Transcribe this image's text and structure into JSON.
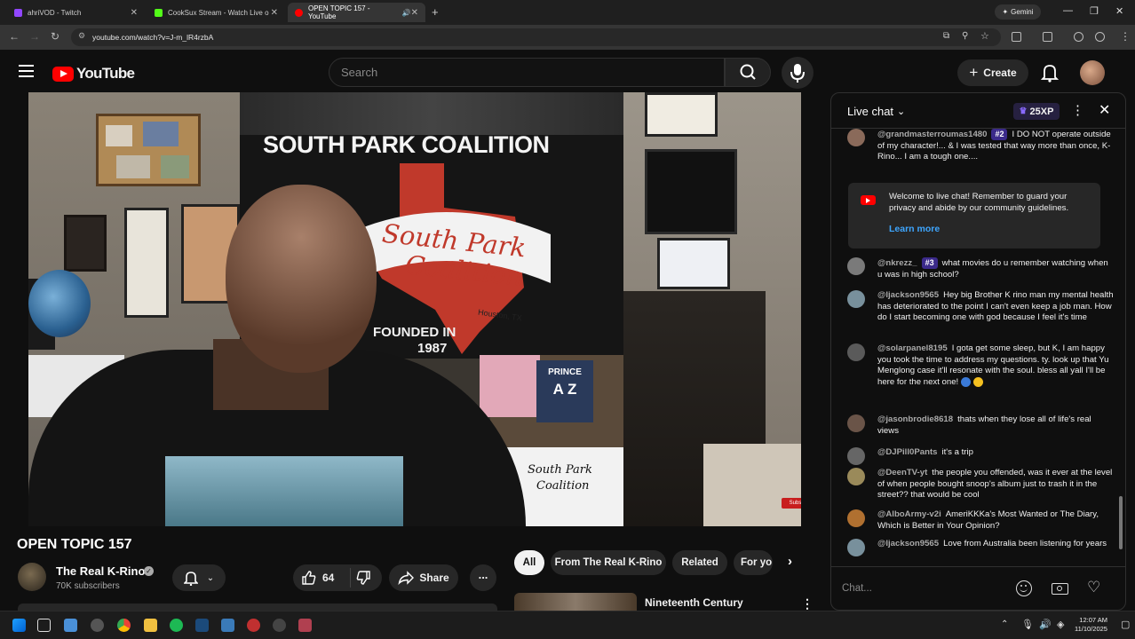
{
  "browser": {
    "tabs": [
      {
        "label": "ahriVOD - Twitch",
        "color": "#9146ff"
      },
      {
        "label": "CookSux Stream - Watch Live o",
        "color": "#53fc18"
      },
      {
        "label": "OPEN TOPIC 157 - YouTube",
        "color": "#ff0000"
      }
    ],
    "new_tab": "+",
    "gemini_label": "Gemini",
    "url": "youtube.com/watch?v=J-m_lR4rzbA"
  },
  "youtube": {
    "logo_text": "YouTube",
    "search_placeholder": "Search",
    "create_label": "Create"
  },
  "video": {
    "banner_title": "SOUTH PARK COALITION",
    "texas_text_1": "South Park",
    "texas_text_2": "Coalition",
    "texas_text_3": "Houston, TX",
    "founded_text": "FOUNDED IN",
    "founded_year": "1987",
    "prince_text": "PRINCE",
    "az_text": "A Z",
    "shirt_text_1": "South Park",
    "shirt_text_2": "Coalition",
    "watermark": "Subscribe"
  },
  "meta": {
    "title": "OPEN TOPIC 157",
    "channel_name": "The Real K-Rino",
    "subscribers": "70K subscribers",
    "likes": "64",
    "share_label": "Share",
    "more_label": "..."
  },
  "chips": {
    "items": [
      "All",
      "From The Real K-Rino",
      "Related",
      "For yo"
    ],
    "rec_title": "Nineteenth Century"
  },
  "chat": {
    "header_title": "Live chat",
    "xp": "25XP",
    "messages": [
      {
        "author": "@grandmasterroumas1480",
        "badge": "#2",
        "text": "I DO NOT operate outside of my character!... & I was tested that way more than once, K-Rino... I am a tough one....",
        "avatar": "#8a6a5a"
      },
      {
        "author": "@nkrezz_",
        "badge": "#3",
        "text": "what movies do u remember watching when u was in high school?",
        "avatar": "#7a7a7a"
      },
      {
        "author": "@ljackson9565",
        "badge": "",
        "text": "Hey big Brother K rino man my mental health has deteriorated to the point I can't even keep a job man. How do I start becoming one with god because I feel it's time",
        "avatar": "#78909c"
      },
      {
        "author": "@solarpanel8195",
        "badge": "",
        "text": "I gota get some sleep, but K, I am happy you took the time to address my questions. ty. look up that Yu Menglong case it'll resonate with the soul. bless all yall I'll be here for the next one!",
        "avatar": "#5a5a5a"
      },
      {
        "author": "@jasonbrodie8618",
        "badge": "",
        "text": "thats when they lose all of life's real views",
        "avatar": "#6a5448"
      },
      {
        "author": "@DJPill0Pants",
        "badge": "",
        "text": "it's a trip",
        "avatar": "#666"
      },
      {
        "author": "@DeenTV-yt",
        "badge": "",
        "text": "the people you offended, was it ever at the level of when people bought snoop's album just to trash it in the street?? that would be cool",
        "avatar": "#9a8a5a"
      },
      {
        "author": "@AlboArmy-v2i",
        "badge": "",
        "text": "AmeriKKKa's Most Wanted or The Diary, Which is Better in Your Opinion?",
        "avatar": "#b07030"
      },
      {
        "author": "@ljackson9565",
        "badge": "",
        "text": "Love from Australia been listening for years",
        "avatar": "#78909c"
      }
    ],
    "welcome_text": "Welcome to live chat! Remember to guard your privacy and abide by our community guidelines.",
    "learn_more": "Learn more",
    "input_placeholder": "Chat..."
  },
  "taskbar": {
    "time": "12:07 AM",
    "date": "11/10/2025"
  }
}
